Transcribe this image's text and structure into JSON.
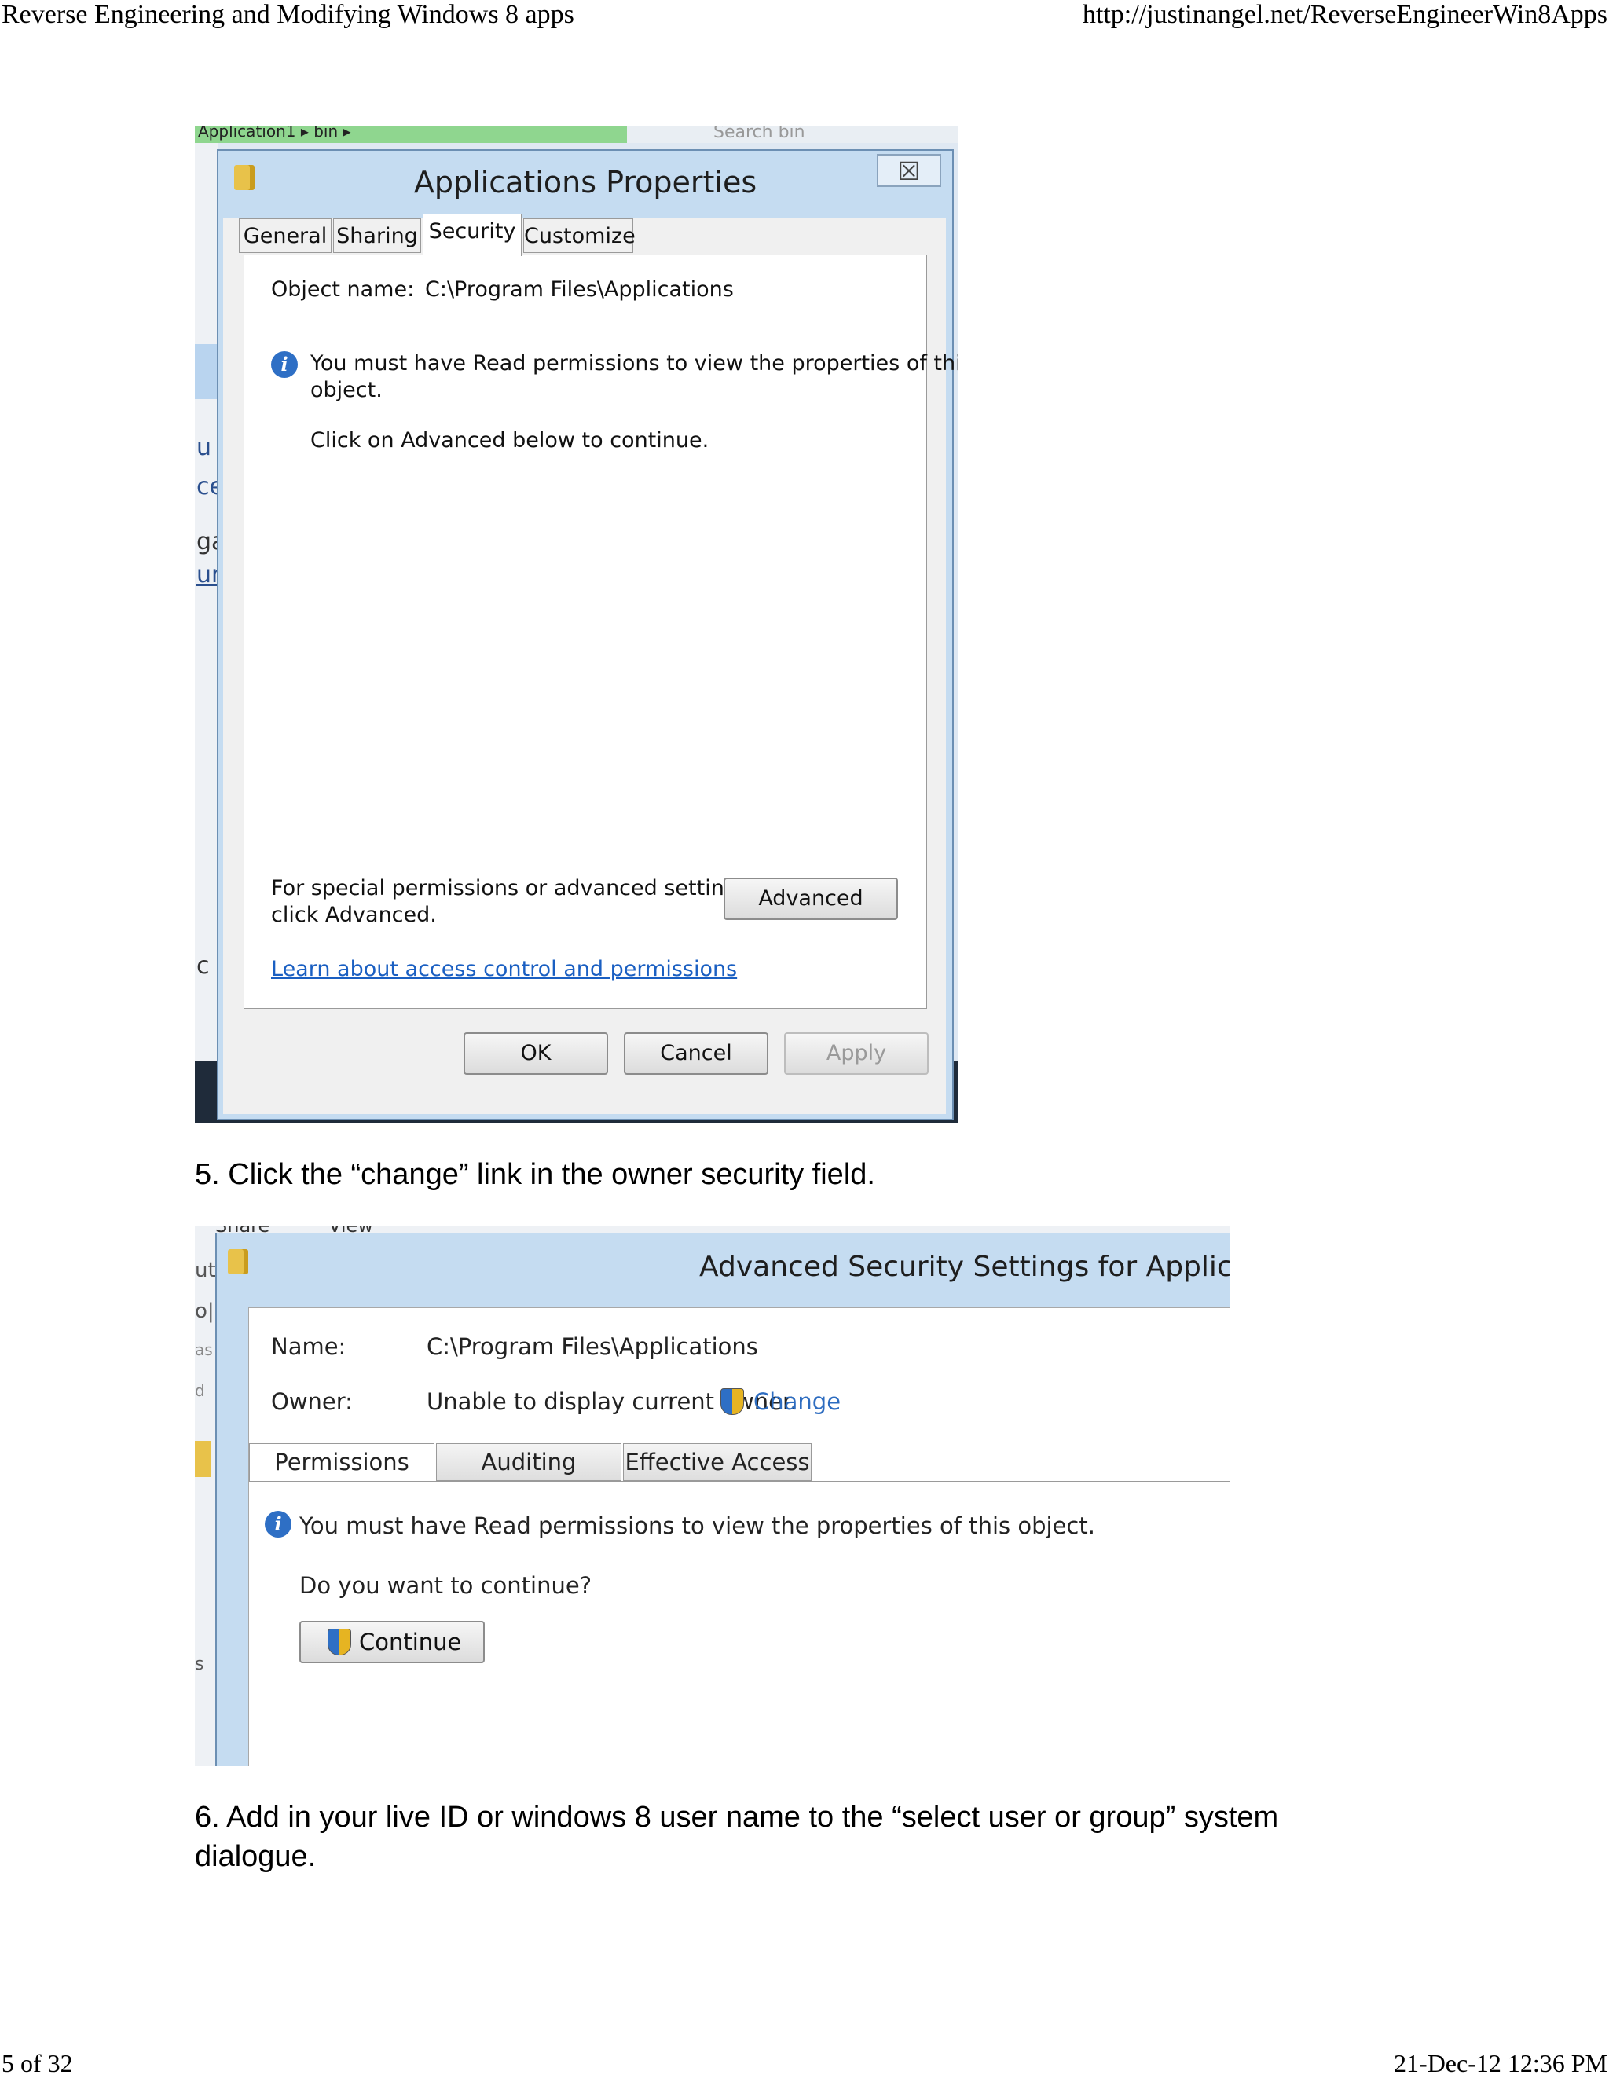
{
  "header": {
    "title": "Reverse Engineering and Modifying Windows 8 apps",
    "url": "http://justinangel.net/ReverseEngineerWin8Apps"
  },
  "footer": {
    "page": "5 of 32",
    "datetime": "21-Dec-12 12:36 PM"
  },
  "screenshot1": {
    "bg_breadcrumb": "Application1 ▸ bin ▸",
    "bg_search": "Search bin",
    "bg_left_fragments": [
      "u",
      "ce",
      "ga",
      "un",
      "c"
    ],
    "dialog": {
      "title": "Applications Properties",
      "close_glyph": "☒",
      "tabs": [
        {
          "label": "General",
          "active": false
        },
        {
          "label": "Sharing",
          "active": false
        },
        {
          "label": "Security",
          "active": true
        },
        {
          "label": "Customize",
          "active": false
        }
      ],
      "object_name_label": "Object name:",
      "object_name_value": "C:\\Program Files\\Applications",
      "info_line1": "You must have Read permissions to view the properties of this",
      "info_line2": "object.",
      "click_advanced": "Click on Advanced below to continue.",
      "special_line1": "For special permissions or advanced settings,",
      "special_line2": "click Advanced.",
      "advanced_button": "Advanced",
      "learn_link": "Learn about access control and permissions",
      "ok_button": "OK",
      "cancel_button": "Cancel",
      "apply_button": "Apply"
    }
  },
  "step5": "5. Click the “change” link in the owner security field.",
  "screenshot2": {
    "bg_top_fragments": [
      "Share",
      "View"
    ],
    "bg_left_fragments": [
      "ut",
      "o|",
      "as",
      "d",
      "s"
    ],
    "dialog": {
      "title": "Advanced Security Settings for Applicatio",
      "name_label": "Name:",
      "name_value": "C:\\Program Files\\Applications",
      "owner_label": "Owner:",
      "owner_value": "Unable to display current owner.",
      "change_link": "Change",
      "tabs": [
        {
          "label": "Permissions",
          "active": true
        },
        {
          "label": "Auditing",
          "active": false
        },
        {
          "label": "Effective Access",
          "active": false
        }
      ],
      "info_text": "You must have Read permissions to view the properties of this object.",
      "question": "Do you want to continue?",
      "continue_button": "Continue"
    }
  },
  "step6_line1": "6. Add in your live ID or windows 8 user name to the “select user or group” system",
  "step6_line2": "dialogue."
}
